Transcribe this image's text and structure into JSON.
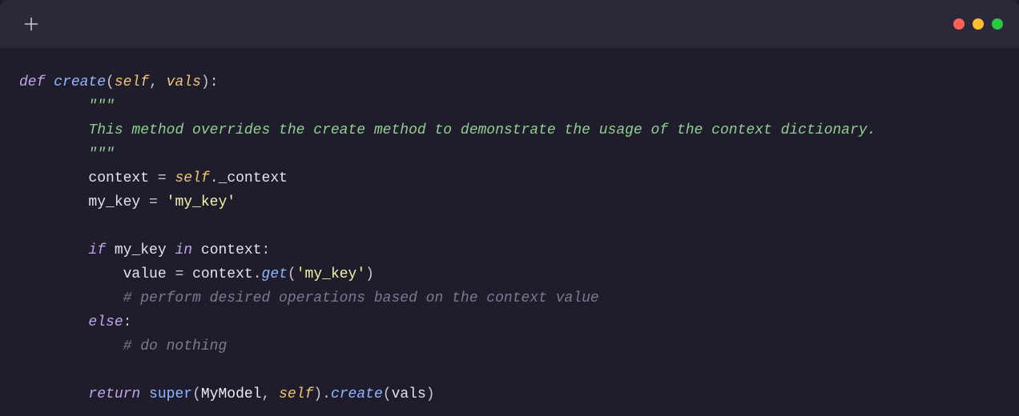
{
  "traffic_lights": {
    "red": "#ff5f56",
    "yellow": "#ffbd2e",
    "green": "#27c93f"
  },
  "code": {
    "kw_def": "def",
    "fn_create": "create",
    "self": "self",
    "param_vals": "vals",
    "doc_open": "\"\"\"",
    "doc_body": "This method overrides the create method to demonstrate the usage of the context dictionary.",
    "doc_close": "\"\"\"",
    "ident_context": "context",
    "attr_context": "_context",
    "ident_mykey": "my_key",
    "str_mykey": "'my_key'",
    "kw_if": "if",
    "kw_in": "in",
    "ident_value": "value",
    "fn_get": "get",
    "comment_ops": "# perform desired operations based on the context value",
    "kw_else": "else",
    "comment_nothing": "# do nothing",
    "kw_return": "return",
    "builtin_super": "super",
    "class_mymodel": "MyModel"
  }
}
